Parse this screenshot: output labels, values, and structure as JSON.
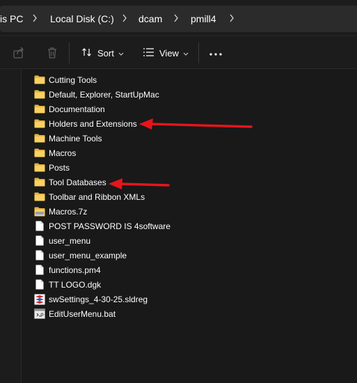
{
  "breadcrumb": {
    "items": [
      "is PC",
      "Local Disk (C:)",
      "dcam",
      "pmill4"
    ]
  },
  "toolbar": {
    "share_icon": "share-icon",
    "delete_icon": "delete-icon",
    "sort_label": "Sort",
    "view_label": "View",
    "more_label": "..."
  },
  "files": [
    {
      "name": "Cutting Tools",
      "icon": "folder-icon"
    },
    {
      "name": "Default, Explorer, StartUpMac",
      "icon": "folder-icon"
    },
    {
      "name": "Documentation",
      "icon": "folder-icon"
    },
    {
      "name": "Holders and Extensions",
      "icon": "folder-icon"
    },
    {
      "name": "Machine Tools",
      "icon": "folder-icon"
    },
    {
      "name": "Macros",
      "icon": "folder-icon"
    },
    {
      "name": "Posts",
      "icon": "folder-icon"
    },
    {
      "name": "Tool Databases",
      "icon": "folder-icon"
    },
    {
      "name": "Toolbar and Ribbon XMLs",
      "icon": "folder-icon"
    },
    {
      "name": "Macros.7z",
      "icon": "archive-icon"
    },
    {
      "name": "POST PASSWORD IS 4software",
      "icon": "document-icon"
    },
    {
      "name": "user_menu",
      "icon": "document-icon"
    },
    {
      "name": "user_menu_example",
      "icon": "document-icon"
    },
    {
      "name": "functions.pm4",
      "icon": "document-icon"
    },
    {
      "name": "TT LOGO.dgk",
      "icon": "document-icon"
    },
    {
      "name": "swSettings_4-30-25.sldreg",
      "icon": "solidworks-registry-icon"
    },
    {
      "name": "EditUserMenu.bat",
      "icon": "batch-file-icon"
    }
  ],
  "annotations": {
    "arrow_color": "#e8141c"
  }
}
